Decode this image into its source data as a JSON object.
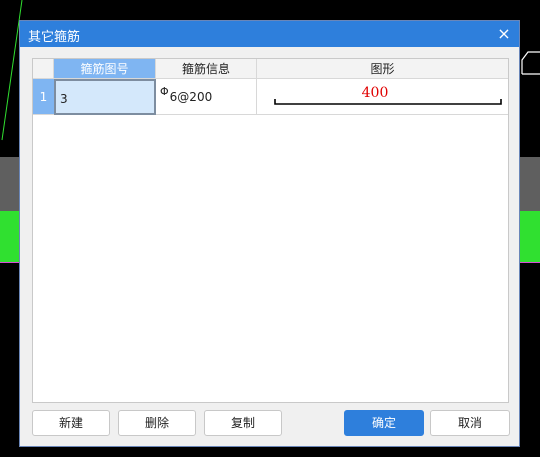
{
  "dialog": {
    "title": "其它箍筋",
    "close_label": "×"
  },
  "table": {
    "columns": [
      "箍筋图号",
      "箍筋信息",
      "图形"
    ],
    "rows": [
      {
        "index": "1",
        "figure_no": "3",
        "rebar_symbol": "Φ",
        "rebar_info": "6@200",
        "shape_dimension": "400"
      }
    ]
  },
  "buttons": {
    "new": "新建",
    "delete": "删除",
    "copy": "复制",
    "ok": "确定",
    "cancel": "取消"
  },
  "colors": {
    "title_bar": "#2e7fdc",
    "header_active": "#7fb5f2",
    "dimension_text": "#e00000",
    "canvas_green": "#30e030"
  }
}
